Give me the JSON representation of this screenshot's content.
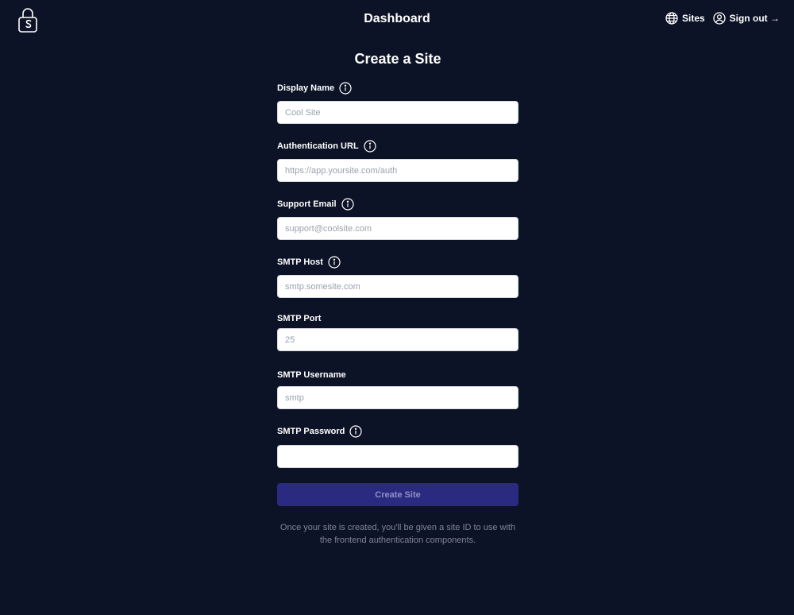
{
  "header": {
    "title": "Dashboard",
    "sites_label": "Sites",
    "signout_label": "Sign out →"
  },
  "form": {
    "title": "Create a Site",
    "fields": [
      {
        "label": "Display Name",
        "placeholder": "Cool Site",
        "value": "",
        "has_info": true
      },
      {
        "label": "Authentication URL",
        "placeholder": "https://app.yoursite.com/auth",
        "value": "",
        "has_info": true
      },
      {
        "label": "Support Email",
        "placeholder": "support@coolsite.com",
        "value": "",
        "has_info": true
      },
      {
        "label": "SMTP Host",
        "placeholder": "smtp.somesite.com",
        "value": "",
        "has_info": true
      },
      {
        "label": "SMTP Port",
        "placeholder": "25",
        "value": "",
        "has_info": false
      },
      {
        "label": "SMTP Username",
        "placeholder": "smtp",
        "value": "",
        "has_info": false
      },
      {
        "label": "SMTP Password",
        "placeholder": "",
        "value": "",
        "has_info": true
      }
    ],
    "submit_label": "Create Site",
    "helper_line1": "Once your site is created, you'll be given a site ID to use with",
    "helper_line2": "the frontend authentication components."
  },
  "colors": {
    "background": "#0d1326",
    "button": "#2a2a80",
    "button_text": "#8f90c2",
    "helper_text": "#7f8596"
  },
  "icons": {
    "logo": "padlock-s-logo-icon",
    "sites": "globe-icon",
    "signout": "user-circle-icon",
    "info": "info-circle-icon"
  }
}
